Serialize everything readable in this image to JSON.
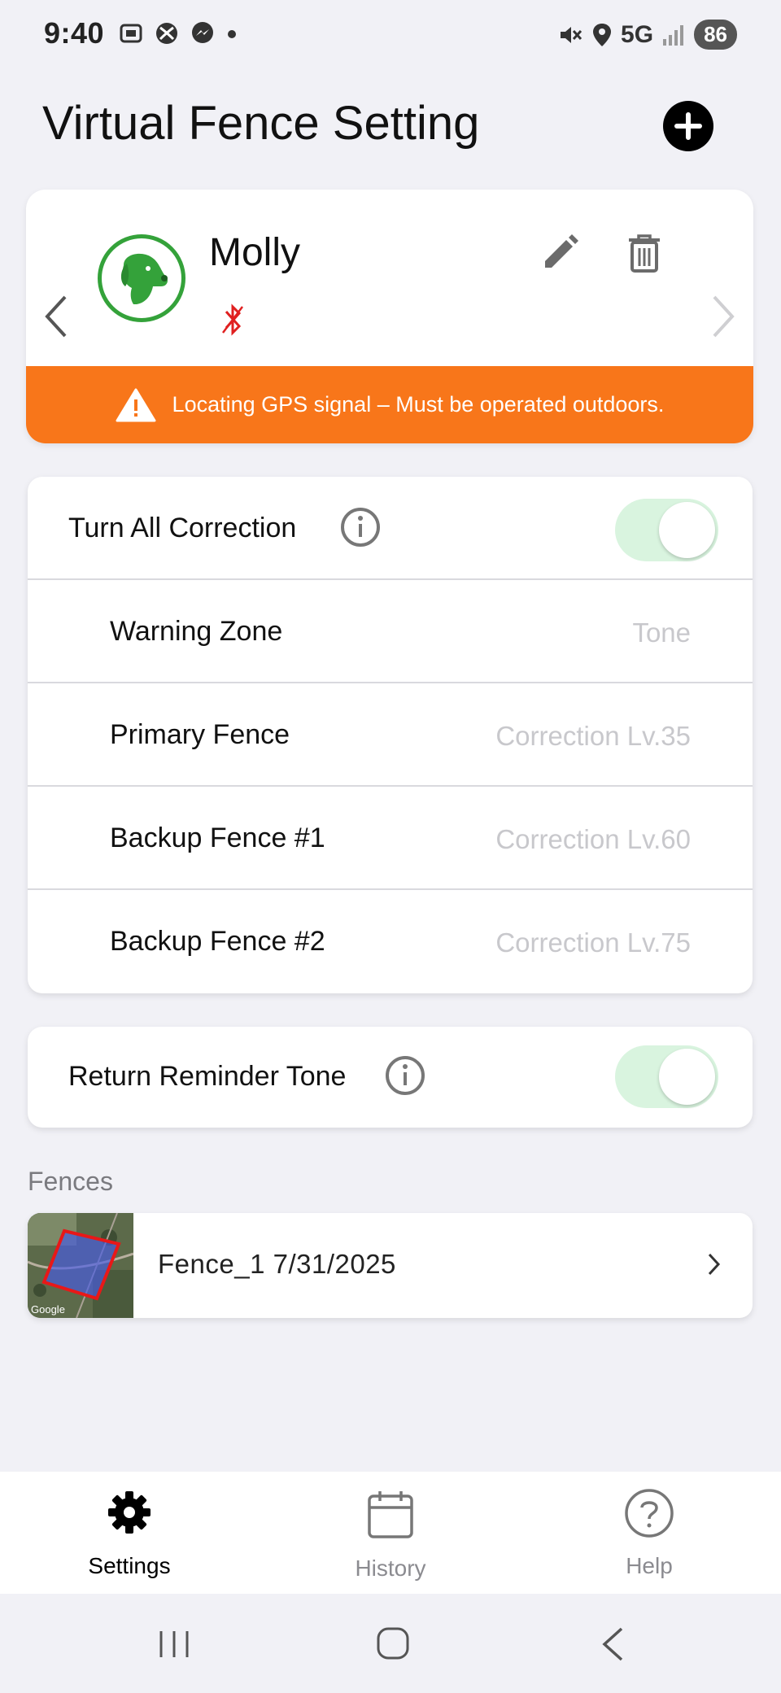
{
  "status_bar": {
    "time": "9:40",
    "network": "5G",
    "battery": "86"
  },
  "header": {
    "title": "Virtual Fence Setting"
  },
  "pet": {
    "name": "Molly",
    "gps_banner": "Locating GPS signal – Must be operated outdoors."
  },
  "correction": {
    "toggle_label": "Turn All Correction",
    "toggle_on": true,
    "rows": [
      {
        "label": "Warning Zone",
        "value": "Tone"
      },
      {
        "label": "Primary Fence",
        "value": "Correction Lv.35"
      },
      {
        "label": "Backup Fence #1",
        "value": "Correction Lv.60"
      },
      {
        "label": "Backup Fence #2",
        "value": "Correction Lv.75"
      }
    ]
  },
  "reminder": {
    "label": "Return Reminder Tone",
    "toggle_on": true
  },
  "fences": {
    "heading": "Fences",
    "items": [
      {
        "name": "Fence_1 7/31/2025",
        "map_credit": "Google"
      }
    ]
  },
  "tabs": [
    {
      "label": "Settings",
      "icon": "gear-icon"
    },
    {
      "label": "History",
      "icon": "calendar-icon"
    },
    {
      "label": "Help",
      "icon": "help-icon"
    }
  ],
  "colors": {
    "accent_orange": "#f8761a",
    "dog_green": "#34a23a",
    "toggle_on": "#d9f4df",
    "bluetooth_off": "#e02020"
  }
}
